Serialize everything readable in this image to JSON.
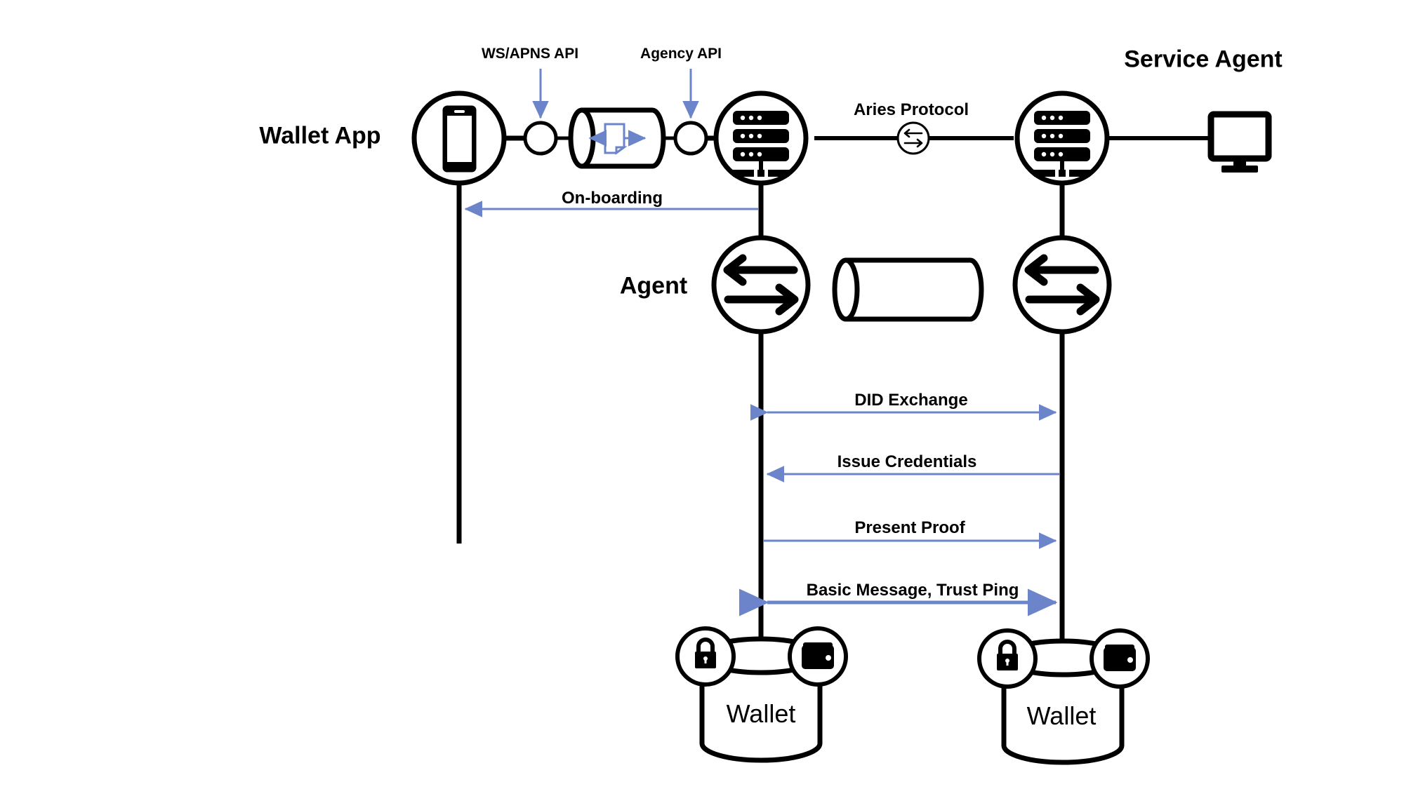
{
  "diagram": {
    "title_service_agent": "Service Agent",
    "title_wallet_app": "Wallet App",
    "label_agent": "Agent",
    "api_labels": {
      "ws_apns": "WS/APNS API",
      "agency": "Agency API"
    },
    "link_label": "Aries Protocol",
    "onboarding_label": "On-boarding",
    "wallet_left_label": "Wallet",
    "wallet_right_label": "Wallet",
    "protocol_flows": [
      {
        "label": "DID Exchange",
        "direction": "both"
      },
      {
        "label": "Issue Credentials",
        "direction": "left"
      },
      {
        "label": "Present Proof",
        "direction": "right"
      },
      {
        "label": "Basic Message, Trust Ping",
        "direction": "both"
      }
    ],
    "icons": {
      "phone": "smartphone-icon",
      "server_left": "server-icon",
      "server_right": "server-icon",
      "monitor": "monitor-icon",
      "exchange": "exchange-arrows-icon",
      "agent_left": "bidirectional-arrows-icon",
      "agent_right": "bidirectional-arrows-icon",
      "lock": "lock-icon",
      "billfold": "wallet-billfold-icon",
      "cylinder_top": "message-queue-cylinder-icon",
      "cylinder_mid": "ledger-cylinder-icon"
    },
    "colors": {
      "stroke": "#000000",
      "arrow_blue": "#6C84C9",
      "background": "#ffffff"
    }
  }
}
